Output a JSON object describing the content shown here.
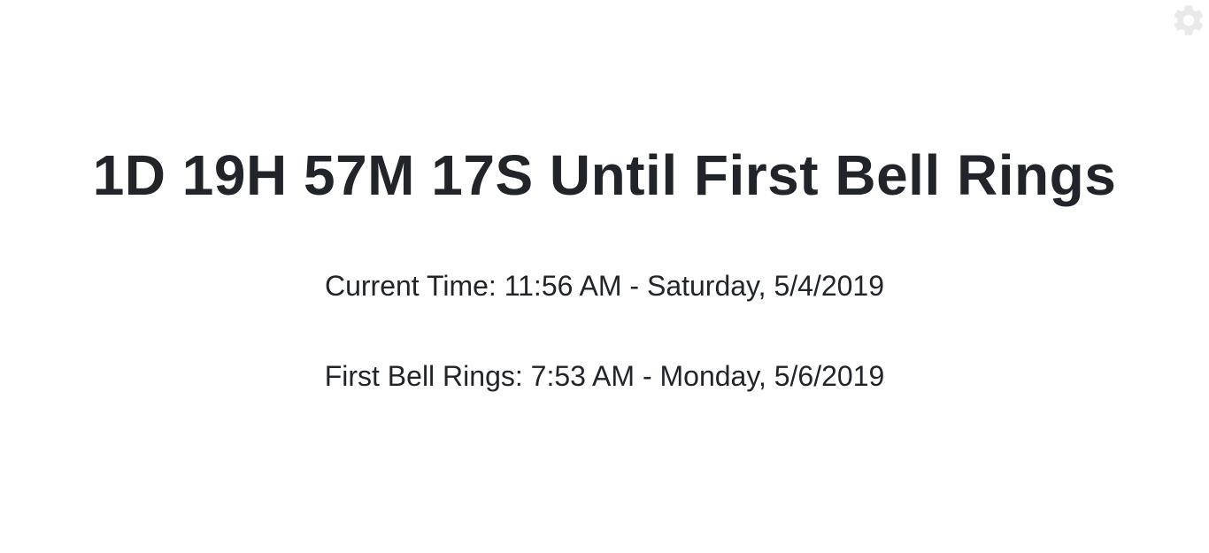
{
  "settings": {
    "icon": "gear-icon",
    "icon_color": "#e9e9e9"
  },
  "countdown": {
    "text": "1D 19H 57M 17S Until First Bell Rings"
  },
  "current_time": {
    "text": "Current Time: 11:56 AM - Saturday, 5/4/2019"
  },
  "first_bell": {
    "text": "First Bell Rings: 7:53 AM - Monday, 5/6/2019"
  },
  "colors": {
    "text": "#212529",
    "background": "#ffffff"
  }
}
